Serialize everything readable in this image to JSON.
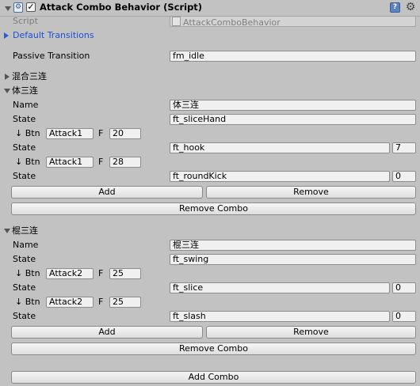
{
  "header": {
    "title": "Attack Combo Behavior (Script)",
    "enabled": true,
    "script_label": "Script",
    "script_value": "AttackComboBehavior"
  },
  "default_transitions": "Default Transitions",
  "passive": {
    "label": "Passive Transition",
    "value": "fm_idle"
  },
  "collapsed_group": "混合三连",
  "labels": {
    "name": "Name",
    "state": "State",
    "btn": "↓ Btn",
    "f": "F",
    "add": "Add",
    "remove": "Remove",
    "remove_combo": "Remove Combo",
    "add_combo": "Add Combo"
  },
  "combos": [
    {
      "title": "体三连",
      "name": "体三连",
      "state": "ft_sliceHand",
      "links": [
        {
          "btn": "Attack1",
          "f": "20",
          "state": "ft_hook",
          "num": "7"
        },
        {
          "btn": "Attack1",
          "f": "28",
          "state": "ft_roundKick",
          "num": "0"
        }
      ]
    },
    {
      "title": "棍三连",
      "name": "棍三连",
      "state": "ft_swing",
      "links": [
        {
          "btn": "Attack2",
          "f": "25",
          "state": "ft_slice",
          "num": "0"
        },
        {
          "btn": "Attack2",
          "f": "25",
          "state": "ft_slash",
          "num": "0"
        }
      ]
    }
  ]
}
